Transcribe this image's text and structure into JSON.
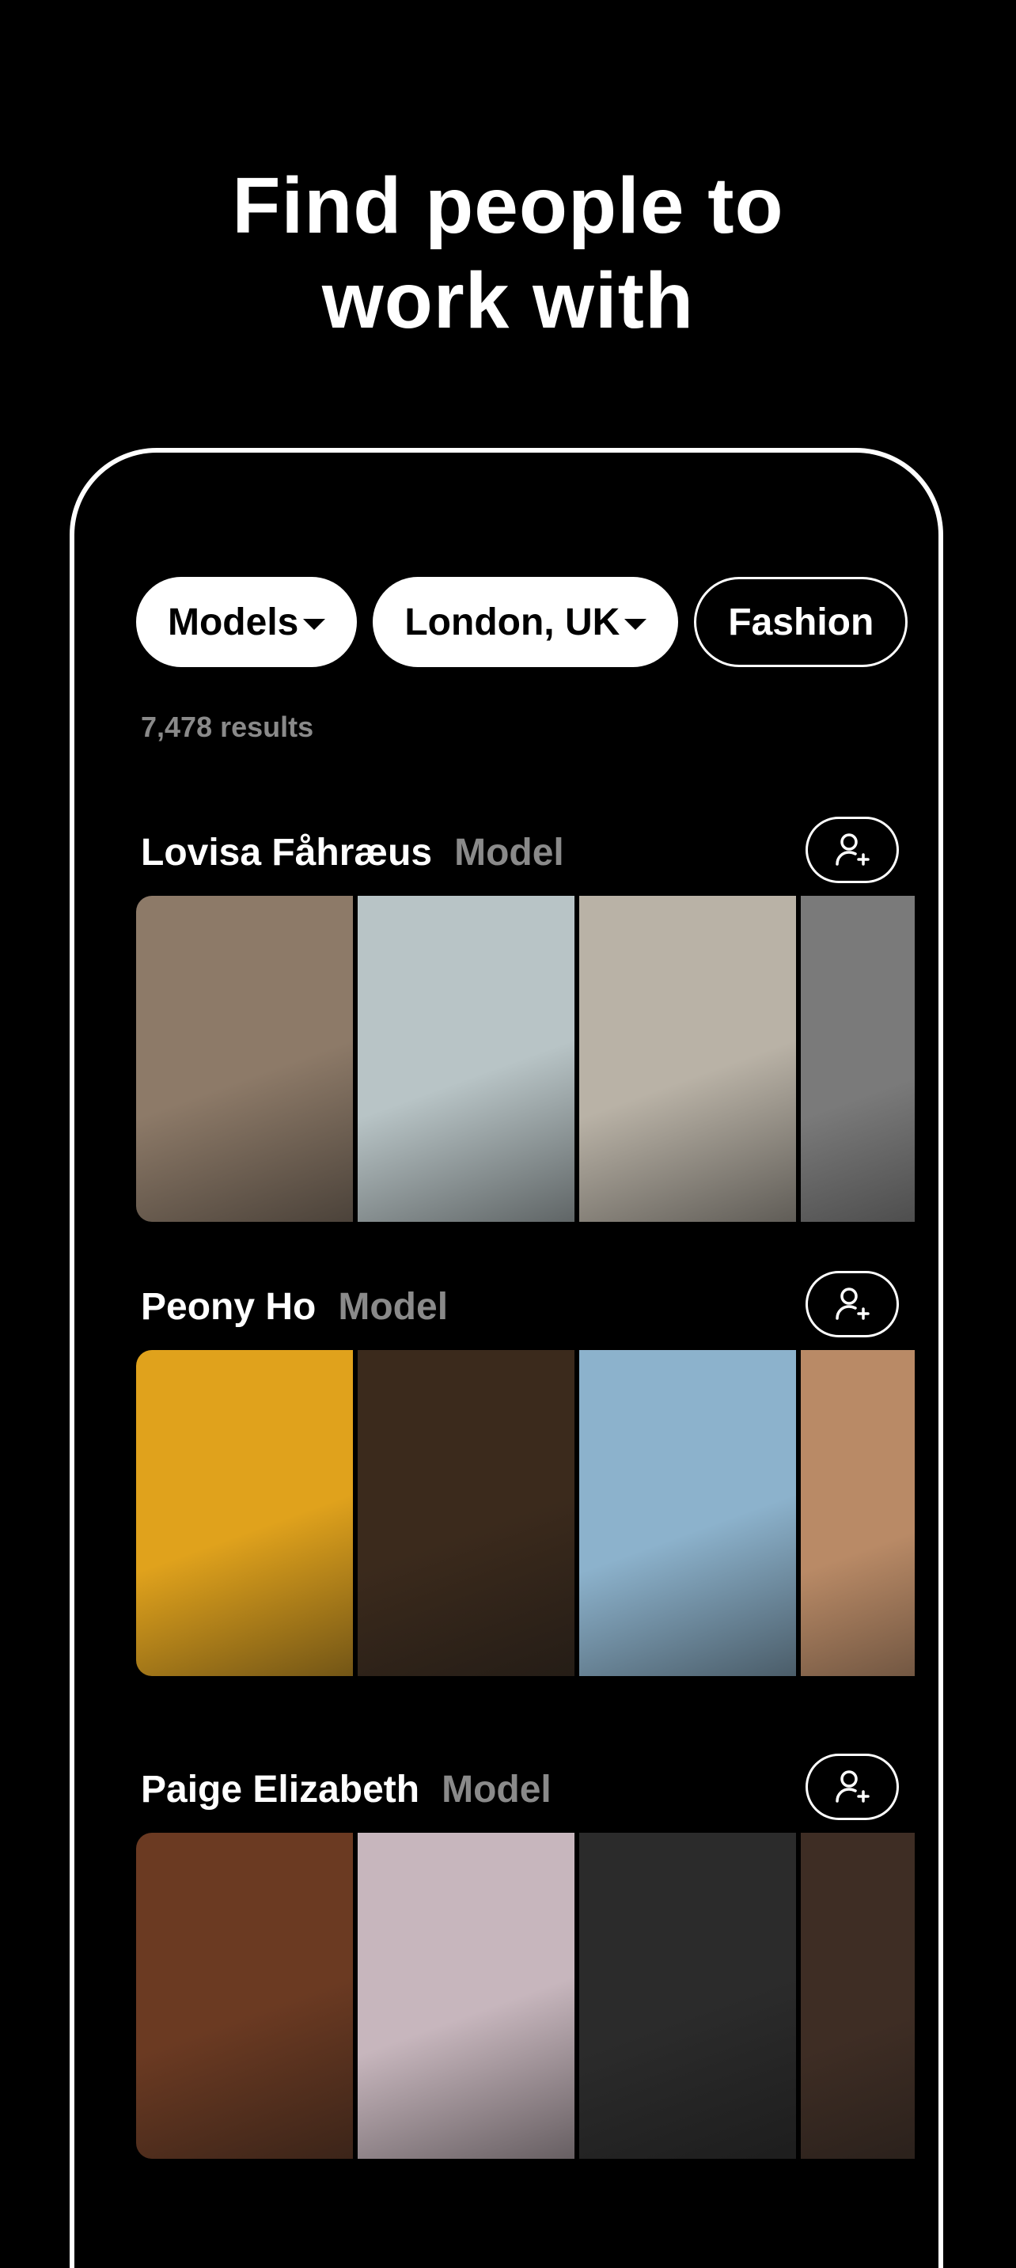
{
  "headline": {
    "line1": "Find people to",
    "line2": "work with"
  },
  "filters": [
    {
      "label": "Models"
    },
    {
      "label": "London, UK"
    },
    {
      "label": "Fashion"
    }
  ],
  "results_text": "7,478 results",
  "people": [
    {
      "name": "Lovisa Fåhræus",
      "role": "Model",
      "photo_colors": [
        "#8d7a68",
        "#b8c4c6",
        "#b9b2a6",
        "#7a7a7a"
      ]
    },
    {
      "name": "Peony Ho",
      "role": "Model",
      "photo_colors": [
        "#e0a21c",
        "#3b2a1c",
        "#8cb2cc",
        "#b98a66"
      ]
    },
    {
      "name": "Paige Elizabeth",
      "role": "Model",
      "photo_colors": [
        "#6b3a22",
        "#c7b6bd",
        "#2b2b2b",
        "#3e2d24"
      ]
    }
  ],
  "icons": {
    "follow": "add-user-icon",
    "dropdown": "caret-down-icon"
  }
}
